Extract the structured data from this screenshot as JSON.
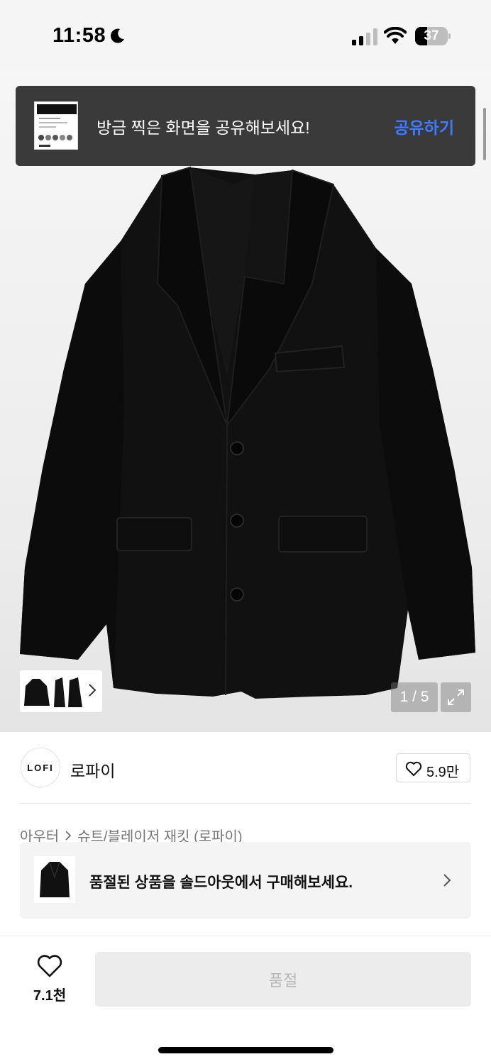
{
  "status_bar": {
    "time": "11:58",
    "battery": "37",
    "battery_level": 0.37
  },
  "toast": {
    "message": "방금 찍은 화면을 공유해보세요!",
    "action_label": "공유하기"
  },
  "gallery": {
    "counter": "1 / 5",
    "current": 1,
    "total": 5
  },
  "brand": {
    "logo_text": "LOFI",
    "name": "로파이",
    "like_count": "5.9만"
  },
  "category": {
    "parent": "아우터",
    "child": "슈트/블레이저 재킷 (로파이)"
  },
  "soldout_banner": {
    "text": "품절된 상품을 솔드아웃에서 구매해보세요."
  },
  "bottom_bar": {
    "wish_count": "7.1천",
    "primary_button": "품절"
  },
  "icons": [
    "moon-icon",
    "signal-icon",
    "wifi-icon",
    "battery-icon",
    "chevron-right-icon",
    "expand-icon",
    "heart-icon"
  ]
}
